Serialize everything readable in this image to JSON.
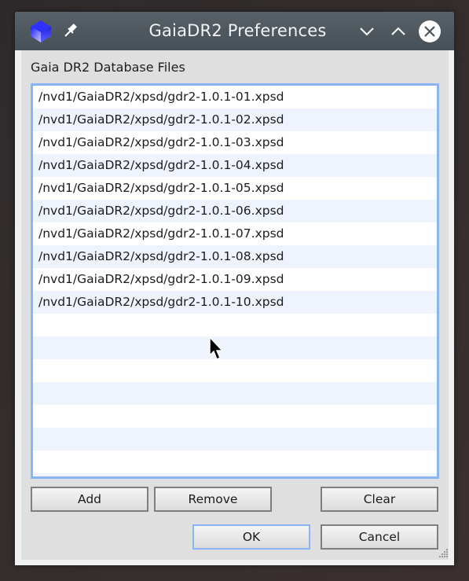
{
  "window": {
    "title": "GaiaDR2 Preferences",
    "icons": {
      "app": "blue-cube-icon",
      "pin": "pin-icon",
      "minimize": "chevron-down-icon",
      "maximize": "chevron-up-icon",
      "close": "close-icon"
    }
  },
  "files_group": {
    "label": "Gaia DR2 Database Files",
    "items": [
      "/nvd1/GaiaDR2/xpsd/gdr2-1.0.1-01.xpsd",
      "/nvd1/GaiaDR2/xpsd/gdr2-1.0.1-02.xpsd",
      "/nvd1/GaiaDR2/xpsd/gdr2-1.0.1-03.xpsd",
      "/nvd1/GaiaDR2/xpsd/gdr2-1.0.1-04.xpsd",
      "/nvd1/GaiaDR2/xpsd/gdr2-1.0.1-05.xpsd",
      "/nvd1/GaiaDR2/xpsd/gdr2-1.0.1-06.xpsd",
      "/nvd1/GaiaDR2/xpsd/gdr2-1.0.1-07.xpsd",
      "/nvd1/GaiaDR2/xpsd/gdr2-1.0.1-08.xpsd",
      "/nvd1/GaiaDR2/xpsd/gdr2-1.0.1-09.xpsd",
      "/nvd1/GaiaDR2/xpsd/gdr2-1.0.1-10.xpsd"
    ]
  },
  "buttons": {
    "add": "Add",
    "remove": "Remove",
    "clear": "Clear",
    "ok": "OK",
    "cancel": "Cancel"
  },
  "colors": {
    "focus_accent": "#8bb4f5",
    "alt_row": "#eef3fd",
    "titlebar": "#50585f"
  }
}
